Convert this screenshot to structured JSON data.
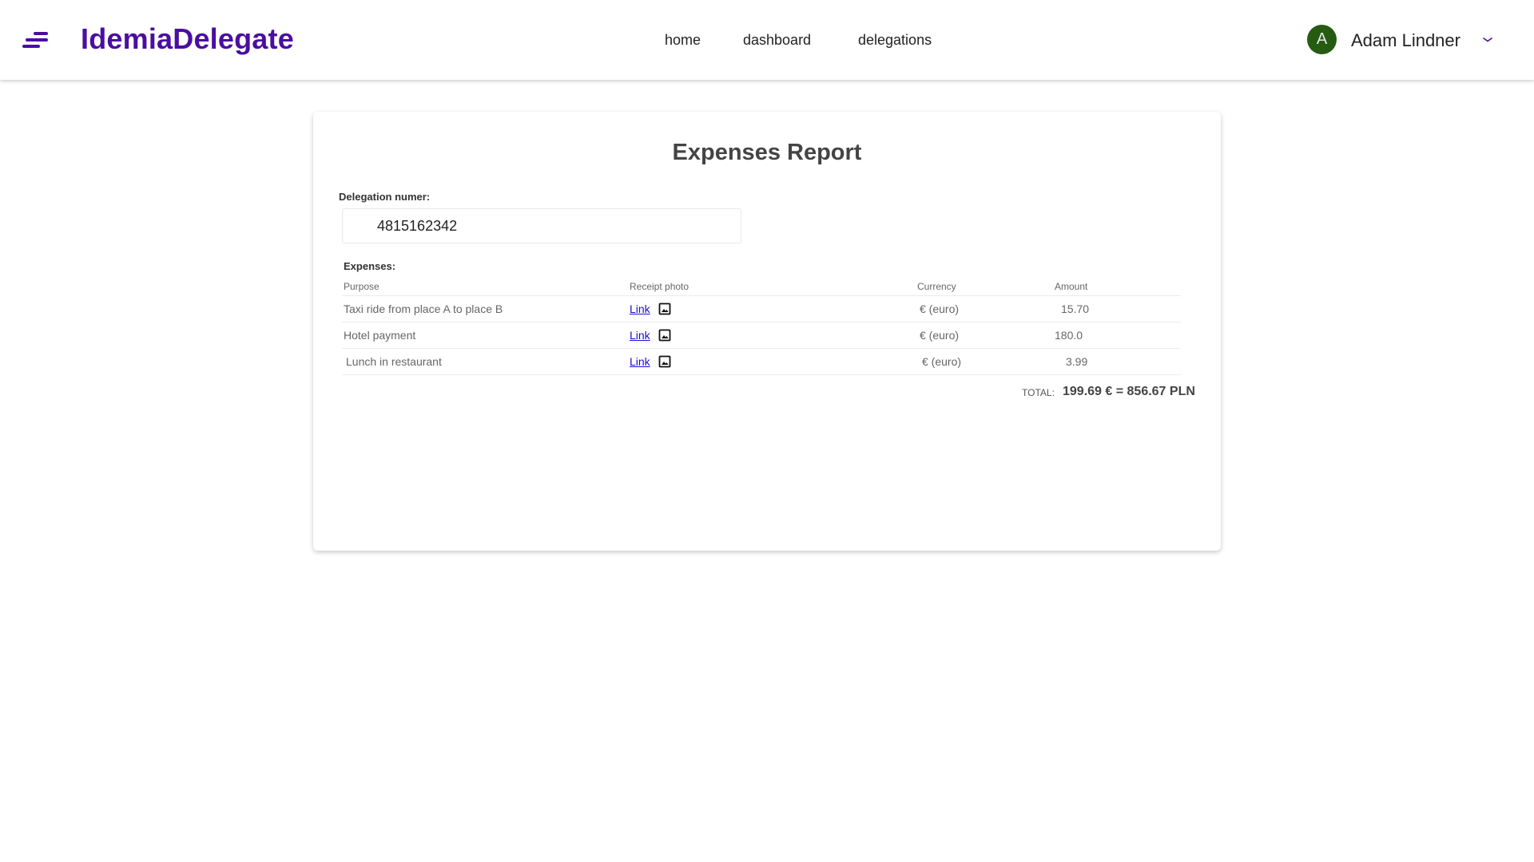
{
  "app": {
    "brand": "IdemiaDelegate",
    "accent_color": "#4a0ea0"
  },
  "nav": {
    "items": [
      {
        "label": "home"
      },
      {
        "label": "dashboard"
      },
      {
        "label": "delegations"
      }
    ]
  },
  "user": {
    "initial": "A",
    "name": "Adam Lindner",
    "avatar_color": "#255c12",
    "menu_icon": "chevron-down-icon"
  },
  "report": {
    "title": "Expenses Report",
    "delegation_label": "Delegation numer:",
    "delegation_number": "4815162342",
    "expenses_label": "Expenses:",
    "columns": {
      "purpose": "Purpose",
      "receipt": "Receipt photo",
      "currency": "Currency",
      "amount": "Amount"
    },
    "rows": [
      {
        "purpose": "Taxi ride from place A to place B",
        "receipt_link": "Link",
        "receipt_icon": "image-icon",
        "currency": "€ (euro)",
        "amount": "15.70"
      },
      {
        "purpose": "Hotel payment",
        "receipt_link": "Link",
        "receipt_icon": "image-icon",
        "currency": "€ (euro)",
        "amount": "180.0"
      },
      {
        "purpose": "Lunch in restaurant",
        "receipt_link": "Link",
        "receipt_icon": "image-icon",
        "currency": "€ (euro)",
        "amount": "3.99"
      }
    ],
    "total_label": "TOTAL:",
    "total_value": "199.69 € = 856.67 PLN"
  }
}
